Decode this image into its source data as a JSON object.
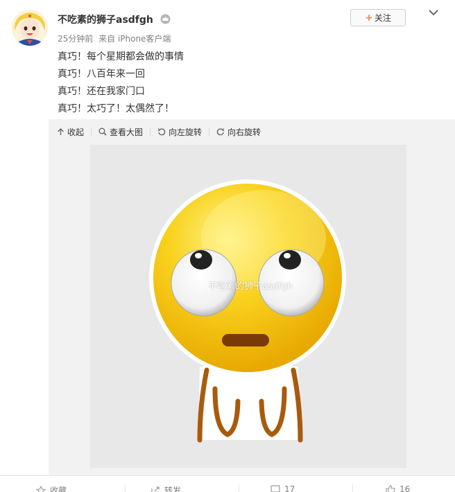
{
  "post": {
    "username": "不吃素的狮子asdfgh",
    "time": "25分钟前",
    "source": "来自 iPhone客户端",
    "lines": [
      "真巧！每个星期都会做的事情",
      "真巧！八百年来一回",
      "真巧！还在我家门口",
      "真巧！太巧了！太偶然了！"
    ],
    "follow_label": "关注",
    "follow_plus": "+"
  },
  "toolbar": {
    "collapse": "收起",
    "view_large": "查看大图",
    "rotate_left": "向左旋转",
    "rotate_right": "向右旋转"
  },
  "image": {
    "watermark": "不吃素的狮子asdfgh"
  },
  "actions": {
    "favorite": "收藏",
    "repost": "转发",
    "comment_count": "17",
    "like_count": "16"
  },
  "colors": {
    "accent": "#ff8140",
    "emoji_yellow": "#f7c600",
    "media_bg": "#f2f2f2"
  }
}
